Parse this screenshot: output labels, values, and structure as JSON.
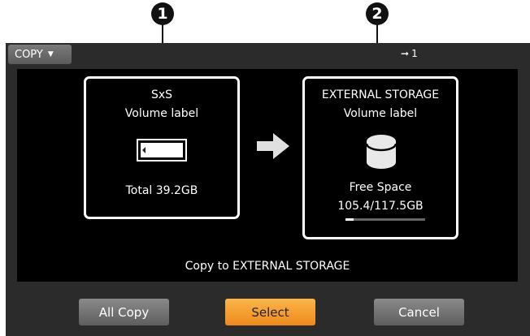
{
  "callouts": [
    "1",
    "2"
  ],
  "topbar": {
    "mode_label": "COPY",
    "caret_icon": "triangle-down-icon",
    "indicator_icon": "arrow-right-icon",
    "indicator_value": "1"
  },
  "source": {
    "media": "SxS",
    "volume_label": "Volume label",
    "icon": "sxs-card-icon",
    "total": "Total 39.2GB"
  },
  "direction_icon": "arrow-right-icon",
  "destination": {
    "media": "EXTERNAL STORAGE",
    "volume_label": "Volume label",
    "icon": "storage-drive-icon",
    "free_space_label": "Free Space",
    "free_space_value": "105.4/117.5GB",
    "used_fraction": 0.1
  },
  "status": "Copy to EXTERNAL STORAGE",
  "buttons": {
    "all_copy": "All Copy",
    "select": "Select",
    "cancel": "Cancel"
  },
  "colors": {
    "accent": "#f5a030",
    "panel_bg": "#000000",
    "screen_bg": "#2b2b2b"
  }
}
